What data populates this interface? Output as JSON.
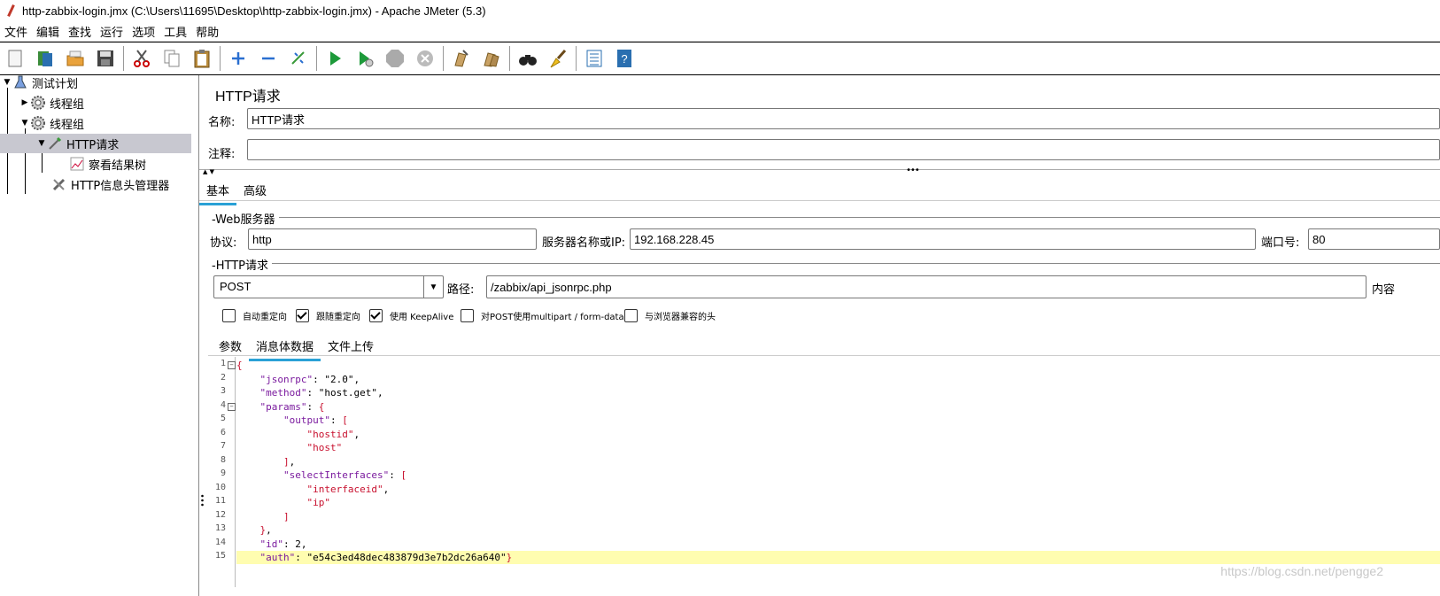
{
  "window": {
    "title": "http-zabbix-login.jmx (C:\\Users\\11695\\Desktop\\http-zabbix-login.jmx) - Apache JMeter (5.3)"
  },
  "menu": [
    "文件",
    "编辑",
    "查找",
    "运行",
    "选项",
    "工具",
    "帮助"
  ],
  "toolbar": {
    "icons": [
      "new-icon",
      "templates-icon",
      "open-icon",
      "save-icon",
      "cut-icon",
      "copy-icon",
      "paste-icon",
      "expand-icon",
      "collapse-icon",
      "toggle-icon",
      "start-icon",
      "start-no-pause-icon",
      "stop-icon",
      "shutdown-icon",
      "clear-icon",
      "clear-all-icon",
      "search-icon",
      "reset-search-icon",
      "function-helper-icon",
      "help-icon"
    ]
  },
  "tree": {
    "test_plan": "测试计划",
    "thread_group_1": "线程组",
    "thread_group_2": "线程组",
    "http_request": "HTTP请求",
    "view_results_tree": "察看结果树",
    "header_manager": "HTTP信息头管理器"
  },
  "panel": {
    "title": "HTTP请求",
    "name_label": "名称:",
    "name_value": "HTTP请求",
    "comment_label": "注释:",
    "comment_value": "",
    "tabs": [
      "基本",
      "高级"
    ],
    "web_server_title": "Web服务器",
    "protocol_label": "协议:",
    "protocol_value": "http",
    "server_label": "服务器名称或IP:",
    "server_value": "192.168.228.45",
    "port_label": "端口号:",
    "port_value": "80",
    "http_request_title": "HTTP请求",
    "method_value": "POST",
    "path_label": "路径:",
    "path_value": "/zabbix/api_jsonrpc.php",
    "content_encoding_label": "内容",
    "checkboxes": [
      {
        "label": "自动重定向",
        "checked": false
      },
      {
        "label": "跟随重定向",
        "checked": true
      },
      {
        "label": "使用 KeepAlive",
        "checked": true
      },
      {
        "label": "对POST使用multipart / form-data",
        "checked": false
      },
      {
        "label": "与浏览器兼容的头",
        "checked": false
      }
    ],
    "body_tabs": [
      "参数",
      "消息体数据",
      "文件上传"
    ],
    "body_lines": [
      "{",
      "    \"jsonrpc\": \"2.0\",",
      "    \"method\": \"host.get\",",
      "    \"params\": {",
      "        \"output\": [",
      "            \"hostid\",",
      "            \"host\"",
      "        ],",
      "        \"selectInterfaces\": [",
      "            \"interfaceid\",",
      "            \"ip\"",
      "        ]",
      "    },",
      "    \"id\": 2,",
      "    \"auth\": \"e54c3ed48dec483879d3e7b2dc26a640\"}"
    ]
  },
  "watermark": "https://blog.csdn.net/pengge2"
}
